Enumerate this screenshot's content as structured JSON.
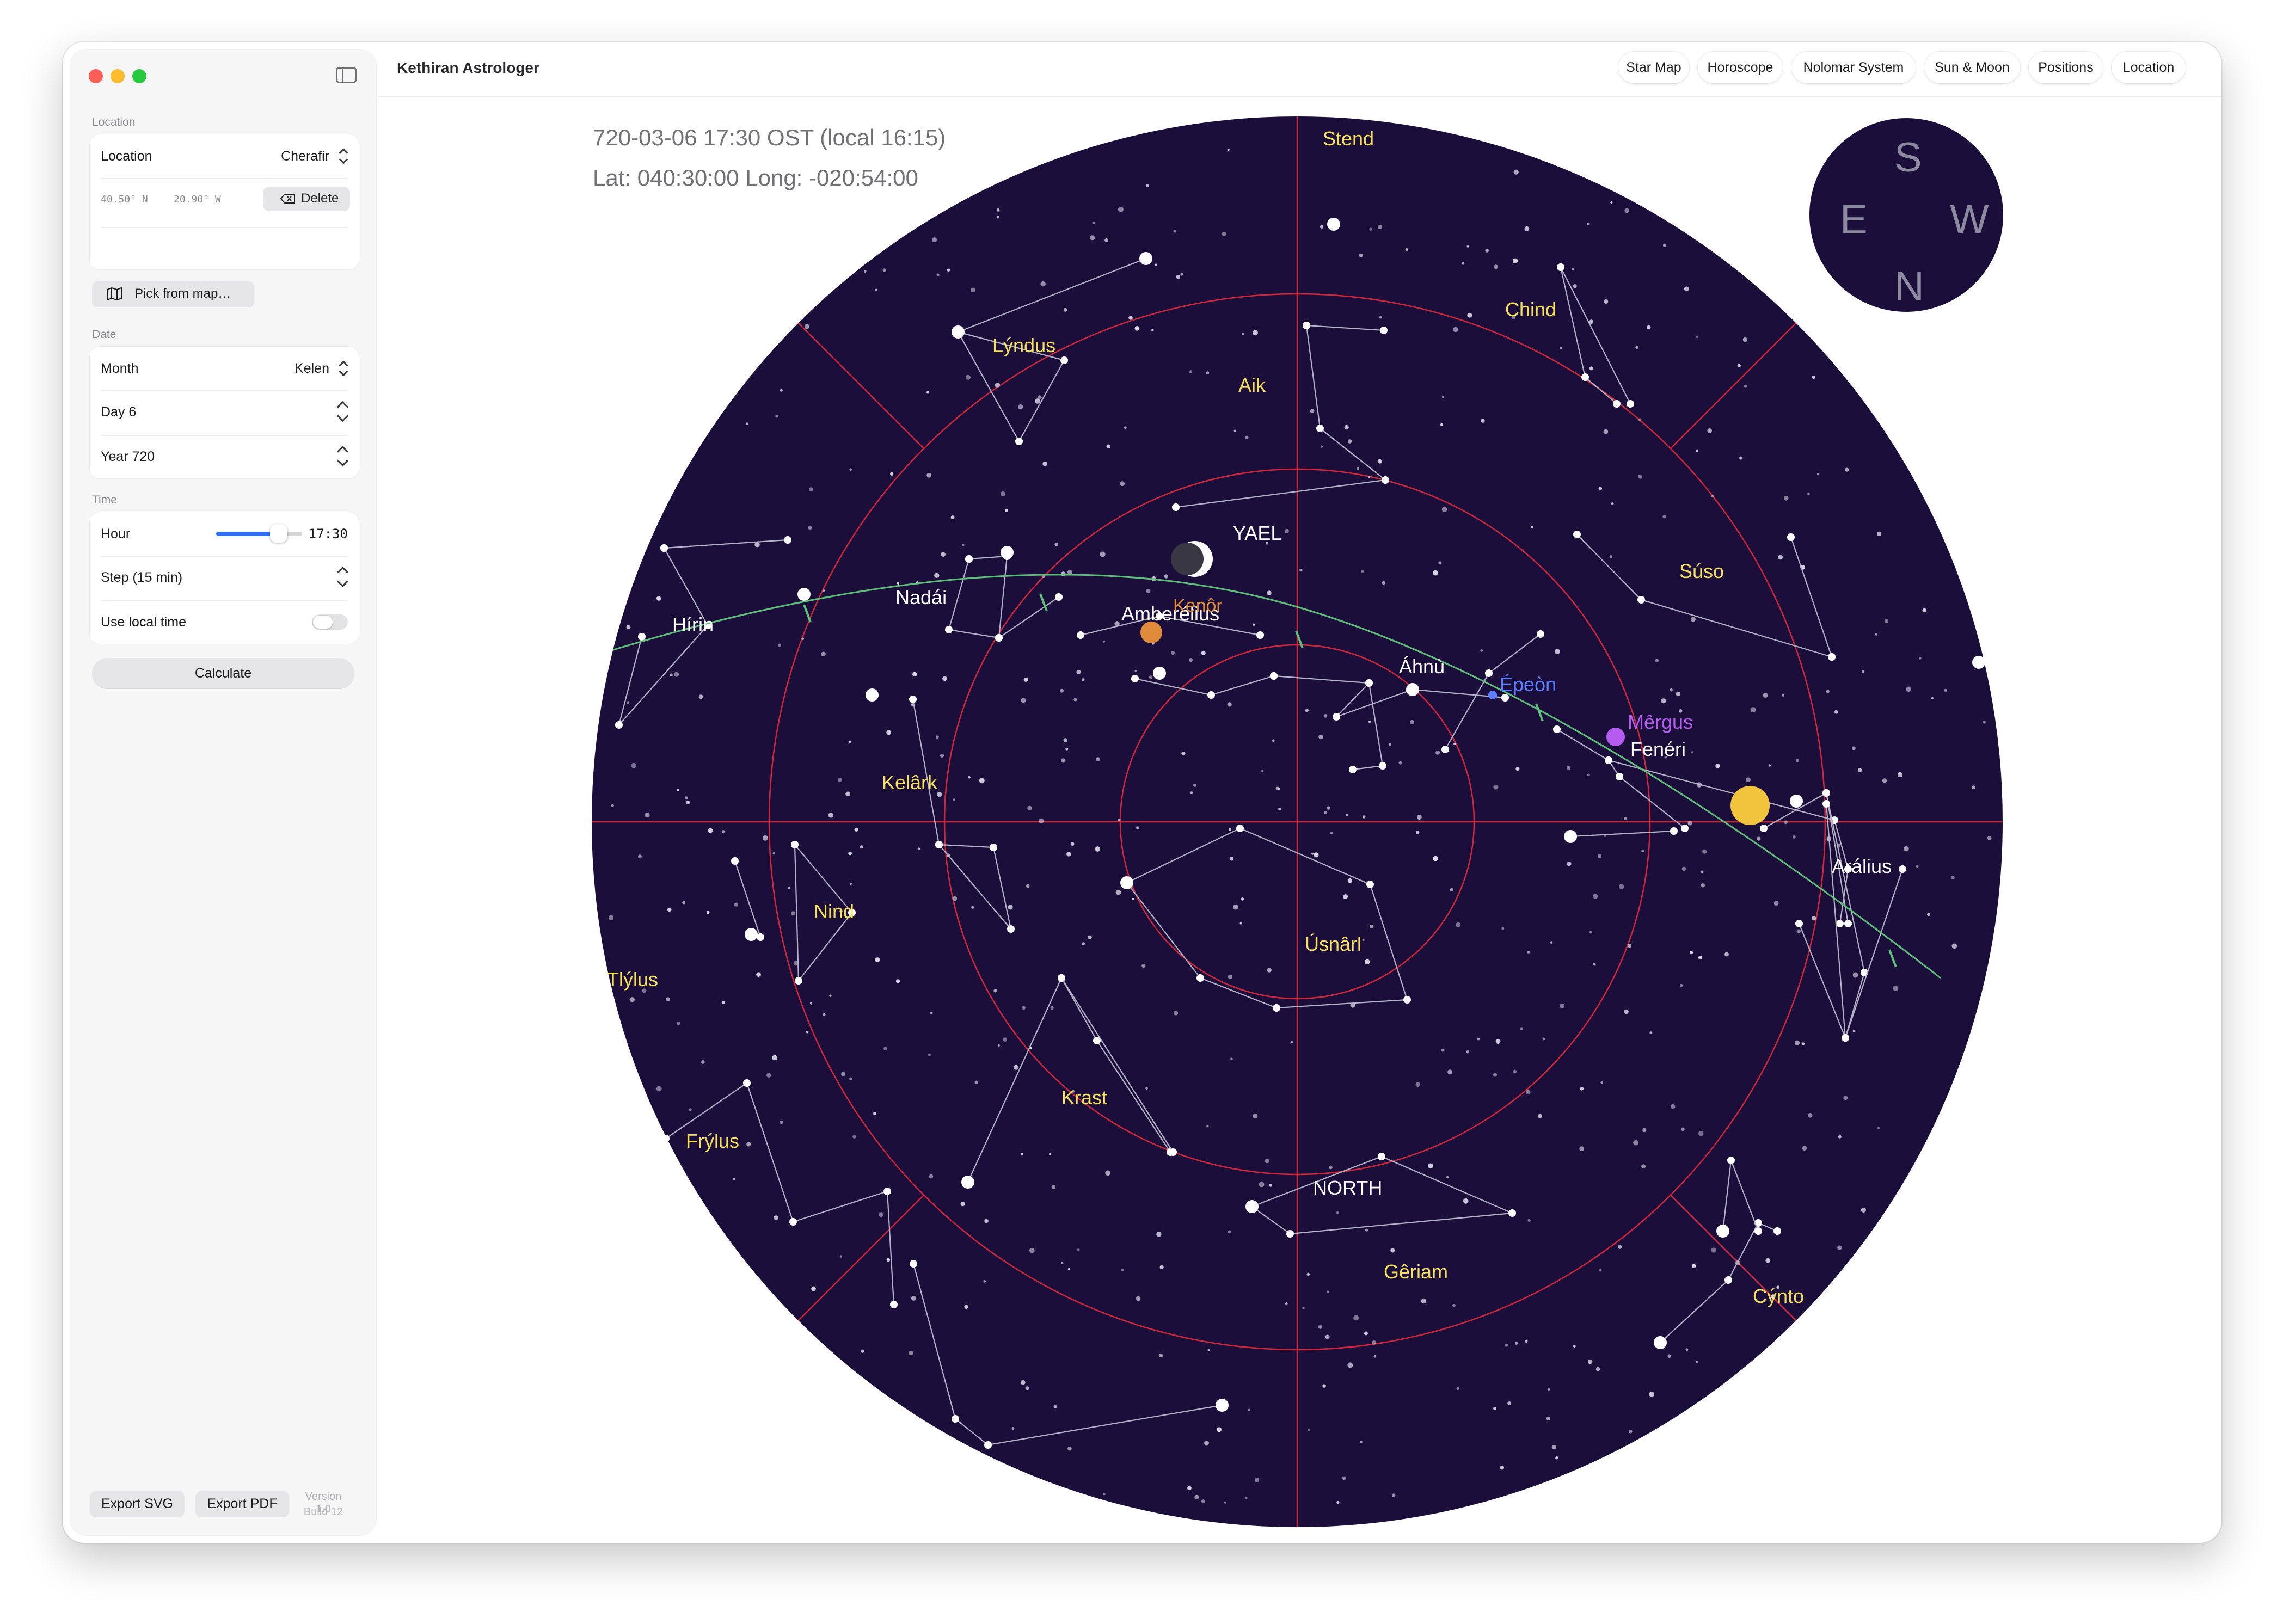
{
  "app": {
    "title": "Kethiran Astrologer"
  },
  "tabs": [
    {
      "label": "Star Map"
    },
    {
      "label": "Horoscope"
    },
    {
      "label": "Nolomar System"
    },
    {
      "label": "Sun & Moon"
    },
    {
      "label": "Positions"
    },
    {
      "label": "Location"
    }
  ],
  "sidebar": {
    "location": {
      "section": "Location",
      "label": "Location",
      "value": "Cherafir",
      "lat": "40.50° N",
      "lon": "20.90° W",
      "delete_label": "Delete",
      "pick_label": "Pick from map…"
    },
    "date": {
      "section": "Date",
      "month_label": "Month",
      "month_value": "Kelen",
      "day_label": "Day 6",
      "year_label": "Year 720"
    },
    "time": {
      "section": "Time",
      "hour_label": "Hour",
      "hour_value": "17:30",
      "hour_fraction": 0.73,
      "step_label": "Step (15 min)",
      "local_label": "Use local time",
      "local_on": false
    },
    "calculate_label": "Calculate",
    "export_svg_label": "Export SVG",
    "export_pdf_label": "Export PDF",
    "version": "Version 1.0",
    "build": "Build 12"
  },
  "map": {
    "datetime": "720-03-06 17:30 OST (local 16:15)",
    "coords": "Lat: 040:30:00 Long: -020:54:00",
    "sky_color": "#1b0e3a",
    "line_color": "#d0283a",
    "ecliptic_color": "#5fbf7a",
    "compass": [
      "S",
      "E",
      "W",
      "N"
    ],
    "constellations": [
      {
        "name": "Stend"
      },
      {
        "name": "Chind"
      },
      {
        "name": "Lýndus"
      },
      {
        "name": "Aik"
      },
      {
        "name": "Súso"
      },
      {
        "name": "Kelârk"
      },
      {
        "name": "Nind"
      },
      {
        "name": "Tlýlus"
      },
      {
        "name": "Úsnârl"
      },
      {
        "name": "Krast"
      },
      {
        "name": "Frýlus"
      },
      {
        "name": "Gêriam"
      },
      {
        "name": "Cýnto"
      }
    ],
    "star_labels": [
      {
        "name": "YAEL"
      },
      {
        "name": "Nadái"
      },
      {
        "name": "Hírin"
      },
      {
        "name": "Amberélius"
      },
      {
        "name": "Áhnù"
      },
      {
        "name": "Fenéri"
      },
      {
        "name": "Arálius"
      },
      {
        "name": "NORTH"
      }
    ],
    "bodies": [
      {
        "name": "Kenôr",
        "color": "#e08a3c"
      },
      {
        "name": "Épeòn",
        "color": "#5b7fff"
      },
      {
        "name": "Mêrgus",
        "color": "#b45cf0"
      }
    ],
    "sun_color": "#f2c33d"
  }
}
